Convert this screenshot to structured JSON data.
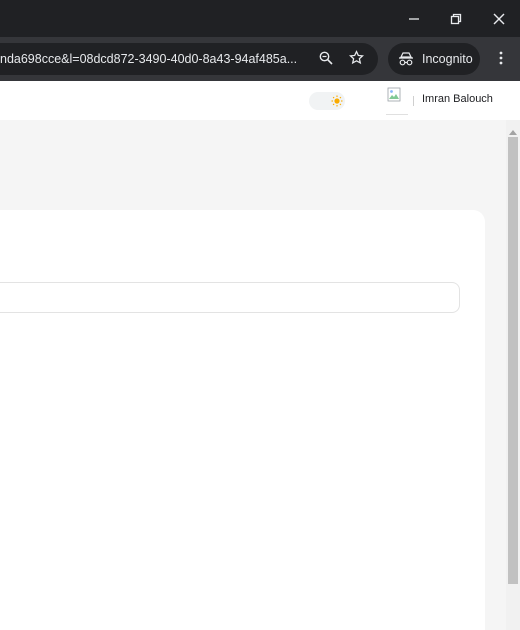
{
  "browser": {
    "url": "nda698cce&l=08dcd872-3490-40d0-8a43-94af485a...",
    "incognito_label": "Incognito",
    "icons": {
      "minimize": "minimize-icon",
      "restore": "restore-icon",
      "close": "close-icon",
      "zoom": "zoom-icon",
      "bookmark": "star-icon",
      "incognito": "incognito-icon",
      "menu": "kebab-menu-icon"
    },
    "colors": {
      "titlebar": "#202124",
      "toolbar": "#35363a",
      "omnibox": "#202124",
      "text": "#e8eaed"
    }
  },
  "header": {
    "theme_toggle_icon": "sun-icon",
    "user_name": "Imran Balouch",
    "avatar_icon": "broken-image-icon"
  },
  "colors": {
    "sun": "#f9ab00",
    "page_bg": "#f5f5f5",
    "card_bg": "#ffffff",
    "scroll_thumb": "#c1c1c1"
  }
}
